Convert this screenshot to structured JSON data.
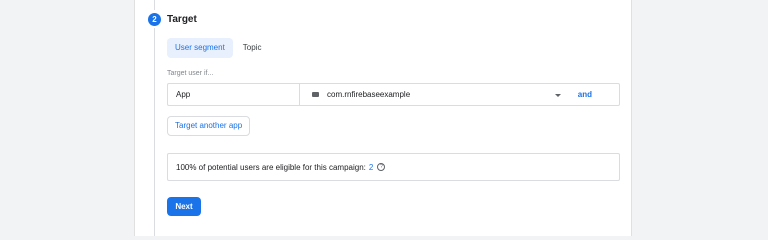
{
  "step": {
    "number": "2",
    "title": "Target"
  },
  "tabs": [
    {
      "label": "User segment",
      "active": true
    },
    {
      "label": "Topic",
      "active": false
    }
  ],
  "targeting": {
    "section_label": "Target user if...",
    "condition": {
      "field": "App",
      "value": "com.rnfirebaseexample",
      "connector": "and"
    },
    "add_button": "Target another app"
  },
  "eligibility": {
    "text": "100% of potential users are eligible for this campaign:",
    "count": "2",
    "help_icon": "?"
  },
  "actions": {
    "next_label": "Next"
  },
  "colors": {
    "accent": "#1a73e8",
    "tab_active_bg": "#e8f0fe",
    "border": "#dadce0",
    "page_bg": "#f1f3f4"
  },
  "icons": {
    "step_badge": "step-number-icon",
    "app": "app-icon",
    "dropdown": "chevron-down-icon",
    "help": "help-circle-icon"
  }
}
